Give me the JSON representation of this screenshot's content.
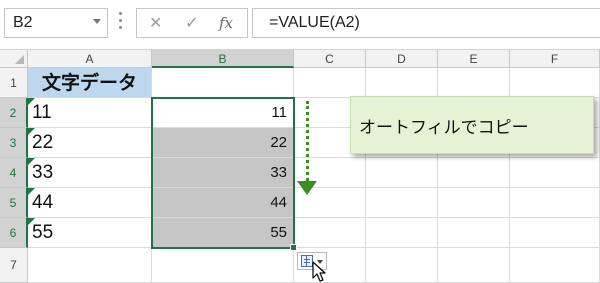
{
  "name_box": "B2",
  "formula_buttons": {
    "cancel": "✕",
    "enter": "✓",
    "function": "fx"
  },
  "formula": "=VALUE(A2)",
  "columns": [
    "A",
    "B",
    "C",
    "D",
    "E",
    "F"
  ],
  "rows": [
    "1",
    "2",
    "3",
    "4",
    "5",
    "6",
    "7"
  ],
  "cells": {
    "A1": "文字データ",
    "A2": "11",
    "A3": "22",
    "A4": "33",
    "A5": "44",
    "A6": "55",
    "B2": "11",
    "B3": "22",
    "B4": "33",
    "B5": "44",
    "B6": "55"
  },
  "callout": "オートフィルでコピー",
  "colors": {
    "header_fill": "#bdd7ee",
    "autofill_fill": "#c6c6c6",
    "selection": "#217346",
    "arrow": "#3d8b25",
    "callout_bg": "#e6f2d4"
  },
  "icons": [
    "chevron-down-icon",
    "cancel-icon",
    "checkmark-icon",
    "function-icon",
    "error-triangle-icon",
    "autofill-options-icon",
    "mouse-cursor-icon"
  ]
}
